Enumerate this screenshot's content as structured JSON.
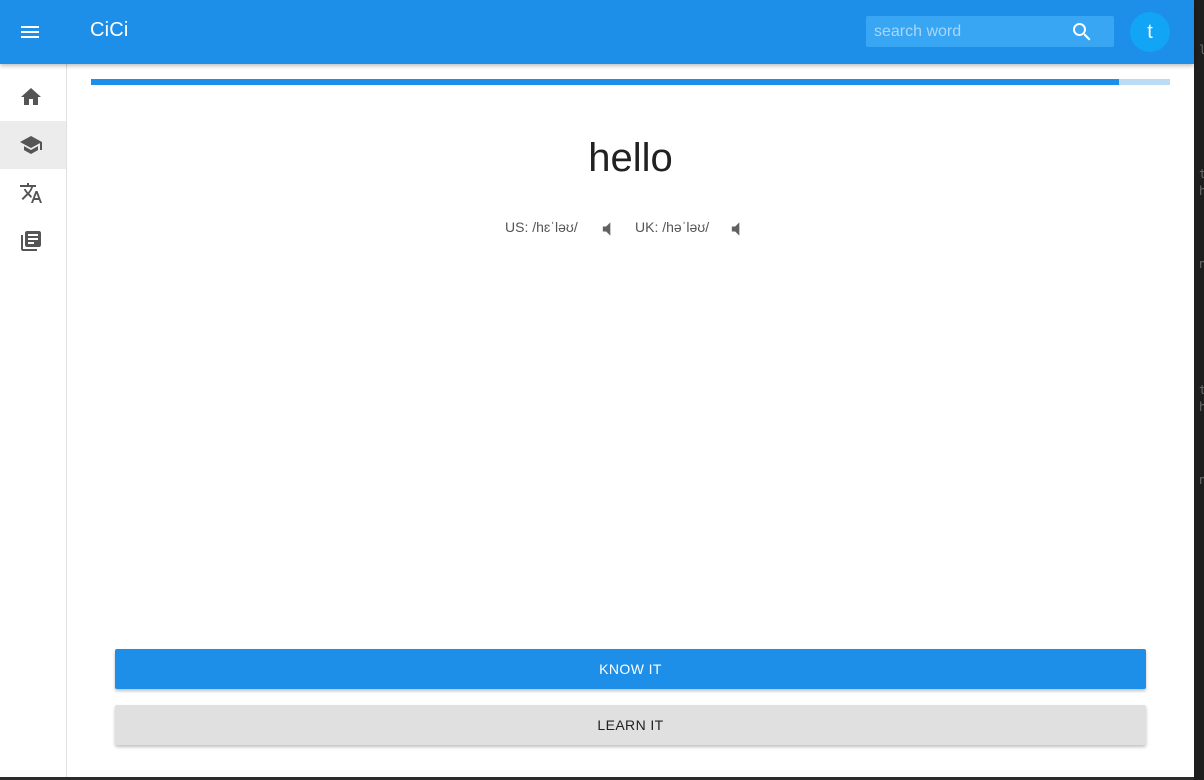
{
  "app": {
    "title": "CiCi"
  },
  "search": {
    "placeholder": "search word"
  },
  "user": {
    "avatar_letter": "t"
  },
  "sidebar": {
    "items": [
      {
        "icon": "home-icon",
        "active": false
      },
      {
        "icon": "school-icon",
        "active": true
      },
      {
        "icon": "translate-icon",
        "active": false
      },
      {
        "icon": "library-books-icon",
        "active": false
      }
    ]
  },
  "progress": {
    "percent": 95.3
  },
  "card": {
    "word": "hello",
    "us_pron": "US: /hɛˈləʊ/",
    "uk_pron": "UK: /həˈləʊ/"
  },
  "actions": {
    "know_label": "KNOW IT",
    "learn_label": "LEARN IT"
  },
  "colors": {
    "primary": "#1e8fe8",
    "avatar": "#12a4f5",
    "secondary_button": "#e0e0e0"
  }
}
